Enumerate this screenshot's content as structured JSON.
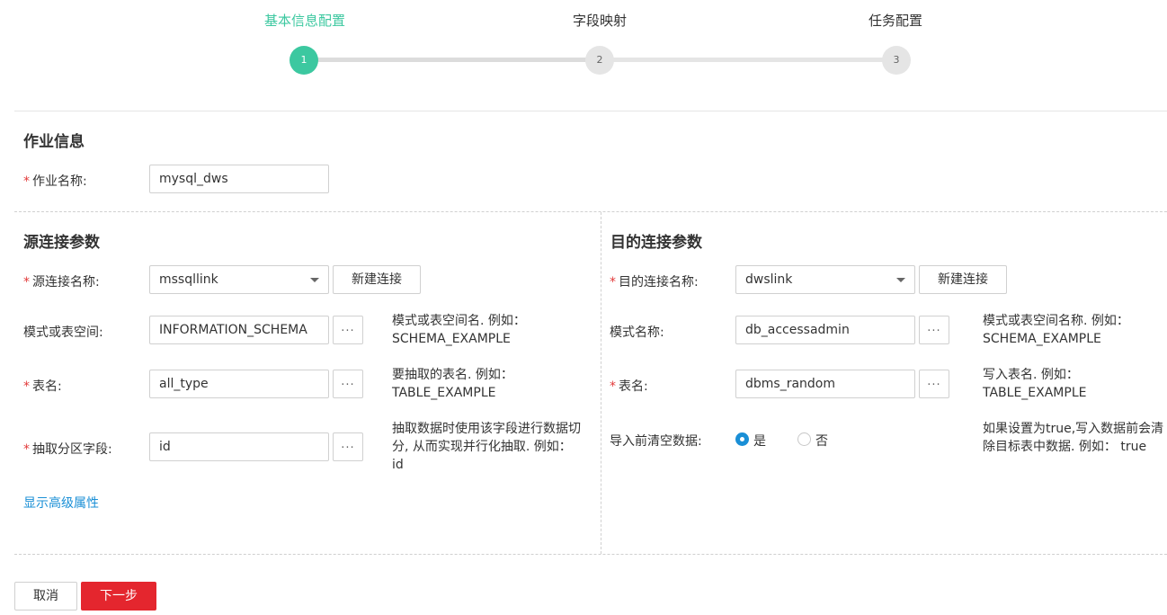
{
  "stepper": {
    "steps": [
      {
        "label": "基本信息配置",
        "number": "1",
        "state": "active"
      },
      {
        "label": "字段映射",
        "number": "2",
        "state": "pending"
      },
      {
        "label": "任务配置",
        "number": "3",
        "state": "pending"
      }
    ],
    "active_color": "#3cc8a0"
  },
  "job_info": {
    "title": "作业信息",
    "job_name_label": "作业名称:",
    "job_name_value": "mysql_dws"
  },
  "source": {
    "title": "源连接参数",
    "link_label": "源连接名称:",
    "link_value": "mssqllink",
    "new_link_button": "新建连接",
    "schema_label": "模式或表空间:",
    "schema_value": "INFORMATION_SCHEMA",
    "schema_hint_line1": "模式或表空间名. 例如：",
    "schema_hint_line2": "SCHEMA_EXAMPLE",
    "table_label": "表名:",
    "table_value": "all_type",
    "table_hint_line1": "要抽取的表名. 例如：",
    "table_hint_line2": "TABLE_EXAMPLE",
    "partition_label": "抽取分区字段:",
    "partition_value": "id",
    "partition_hint_line1": "抽取数据时使用该字段进行数据切",
    "partition_hint_line2": "分, 从而实现并行化抽取. 例如：",
    "partition_hint_line3": "id",
    "advanced_link": "显示高级属性",
    "browse_label": "..."
  },
  "destination": {
    "title": "目的连接参数",
    "link_label": "目的连接名称:",
    "link_value": "dwslink",
    "new_link_button": "新建连接",
    "schema_label": "模式名称:",
    "schema_value": "db_accessadmin",
    "schema_hint_line1": "模式或表空间名称. 例如：",
    "schema_hint_line2": "SCHEMA_EXAMPLE",
    "table_label": "表名:",
    "table_value": "dbms_random",
    "table_hint_line1": "写入表名. 例如：",
    "table_hint_line2": "TABLE_EXAMPLE",
    "clear_label": "导入前清空数据:",
    "clear_yes": "是",
    "clear_no": "否",
    "clear_selected": "是",
    "clear_hint_line1": "如果设置为true,写入数据前会清",
    "clear_hint_line2": "除目标表中数据. 例如： true",
    "browse_label": "..."
  },
  "footer": {
    "cancel_button": "取消",
    "next_button": "下一步",
    "next_color": "#e4262e"
  },
  "required_mark": "*"
}
